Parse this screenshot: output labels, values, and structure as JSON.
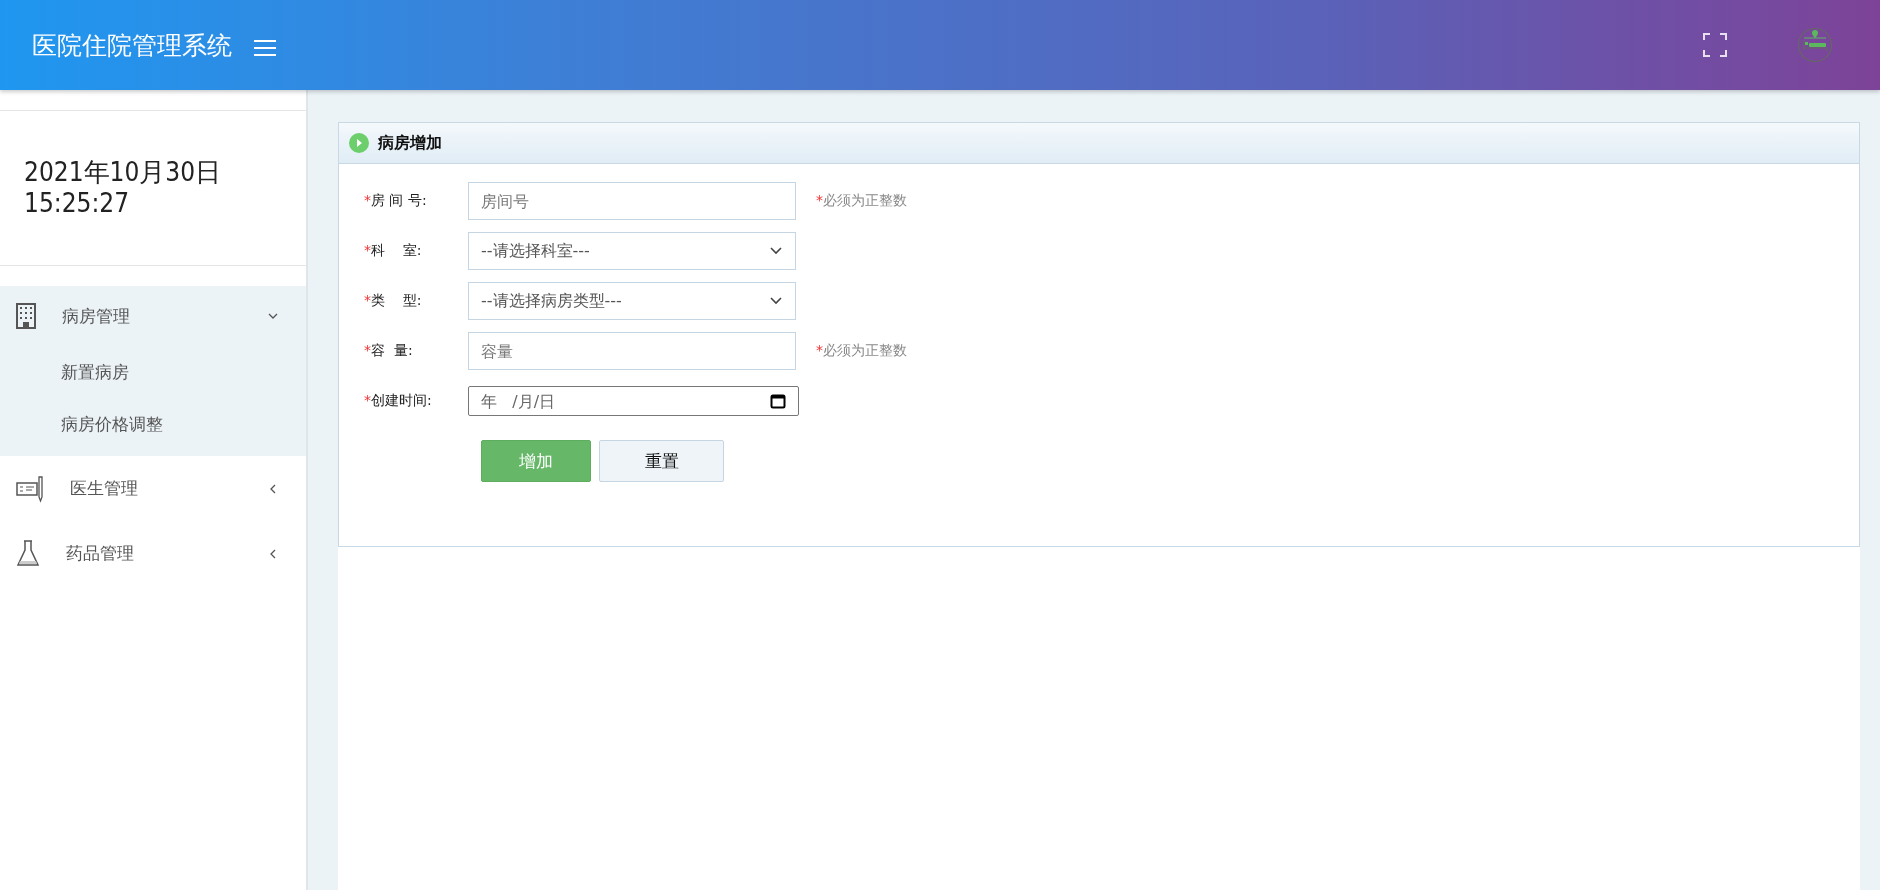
{
  "header": {
    "title": "医院住院管理系统"
  },
  "sidebar": {
    "date": "2021年10月30日",
    "time": "15:25:27",
    "menu": [
      {
        "label": "病房管理",
        "expanded": true,
        "children": [
          {
            "label": "新置病房"
          },
          {
            "label": "病房价格调整"
          }
        ]
      },
      {
        "label": "医生管理",
        "expanded": false
      },
      {
        "label": "药品管理",
        "expanded": false
      }
    ]
  },
  "panel": {
    "title": "病房增加",
    "fields": [
      {
        "kind": "text",
        "mark": "*",
        "label": "房 间 号:",
        "placeholder": "房间号",
        "hint_mark": "*",
        "hint": "必须为正整数"
      },
      {
        "kind": "select",
        "mark": "*",
        "label": "科    室:",
        "value": "--请选择科室---"
      },
      {
        "kind": "select",
        "mark": "*",
        "label": "类    型:",
        "value": "--请选择病房类型---"
      },
      {
        "kind": "text",
        "mark": "*",
        "label": "容  量:",
        "placeholder": "容量",
        "hint_mark": "*",
        "hint": "必须为正整数"
      },
      {
        "kind": "date",
        "mark": "*",
        "label": "创建时间:",
        "value": "年   /月/日"
      }
    ],
    "buttons": [
      {
        "label": "增加",
        "kind": "primary"
      },
      {
        "label": "重置",
        "kind": "default"
      }
    ]
  }
}
